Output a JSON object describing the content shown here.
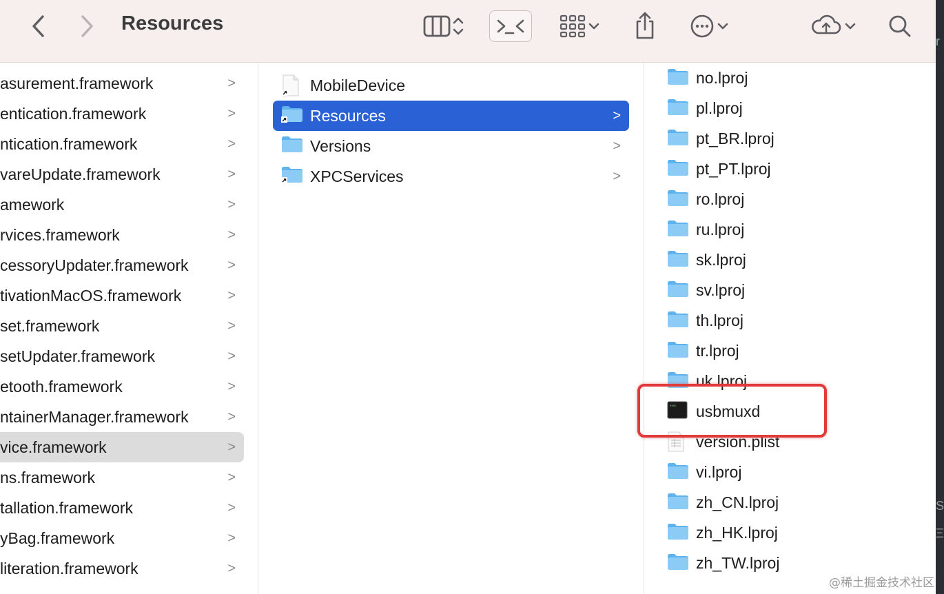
{
  "toolbar": {
    "title": "Resources",
    "icons": [
      "back-icon",
      "forward-icon",
      "column-view-icon",
      "updown-icon",
      "terminal-icon",
      "grid-view-icon",
      "chevron-down-icon",
      "share-icon",
      "more-icon",
      "chevron-down-icon",
      "icloud-icon",
      "chevron-down-icon",
      "search-icon"
    ]
  },
  "column1": {
    "items": [
      {
        "label": "asurement.framework"
      },
      {
        "label": "entication.framework"
      },
      {
        "label": "ntication.framework"
      },
      {
        "label": "vareUpdate.framework"
      },
      {
        "label": "amework"
      },
      {
        "label": "rvices.framework"
      },
      {
        "label": "cessoryUpdater.framework"
      },
      {
        "label": "tivationMacOS.framework"
      },
      {
        "label": "set.framework"
      },
      {
        "label": "setUpdater.framework"
      },
      {
        "label": "etooth.framework"
      },
      {
        "label": "ntainerManager.framework"
      },
      {
        "label": "vice.framework"
      },
      {
        "label": "ns.framework"
      },
      {
        "label": "tallation.framework"
      },
      {
        "label": "yBag.framework"
      },
      {
        "label": "literation.framework"
      }
    ],
    "chevron": ">"
  },
  "column2": {
    "items": [
      {
        "label": "MobileDevice"
      },
      {
        "label": "Resources"
      },
      {
        "label": "Versions"
      },
      {
        "label": "XPCServices"
      }
    ],
    "chevron": ">"
  },
  "column3": {
    "items": [
      {
        "label": "no.lproj"
      },
      {
        "label": "pl.lproj"
      },
      {
        "label": "pt_BR.lproj"
      },
      {
        "label": "pt_PT.lproj"
      },
      {
        "label": "ro.lproj"
      },
      {
        "label": "ru.lproj"
      },
      {
        "label": "sk.lproj"
      },
      {
        "label": "sv.lproj"
      },
      {
        "label": "th.lproj"
      },
      {
        "label": "tr.lproj"
      },
      {
        "label": "uk.lproj"
      },
      {
        "label": "usbmuxd"
      },
      {
        "label": "version.plist"
      },
      {
        "label": "vi.lproj"
      },
      {
        "label": "zh_CN.lproj"
      },
      {
        "label": "zh_HK.lproj"
      },
      {
        "label": "zh_TW.lproj"
      }
    ]
  },
  "watermark": "@稀土掘金技术社区",
  "colors": {
    "selection": "#2a62d6",
    "highlight": "#e03a3a",
    "folder": "#5fb2ec"
  }
}
